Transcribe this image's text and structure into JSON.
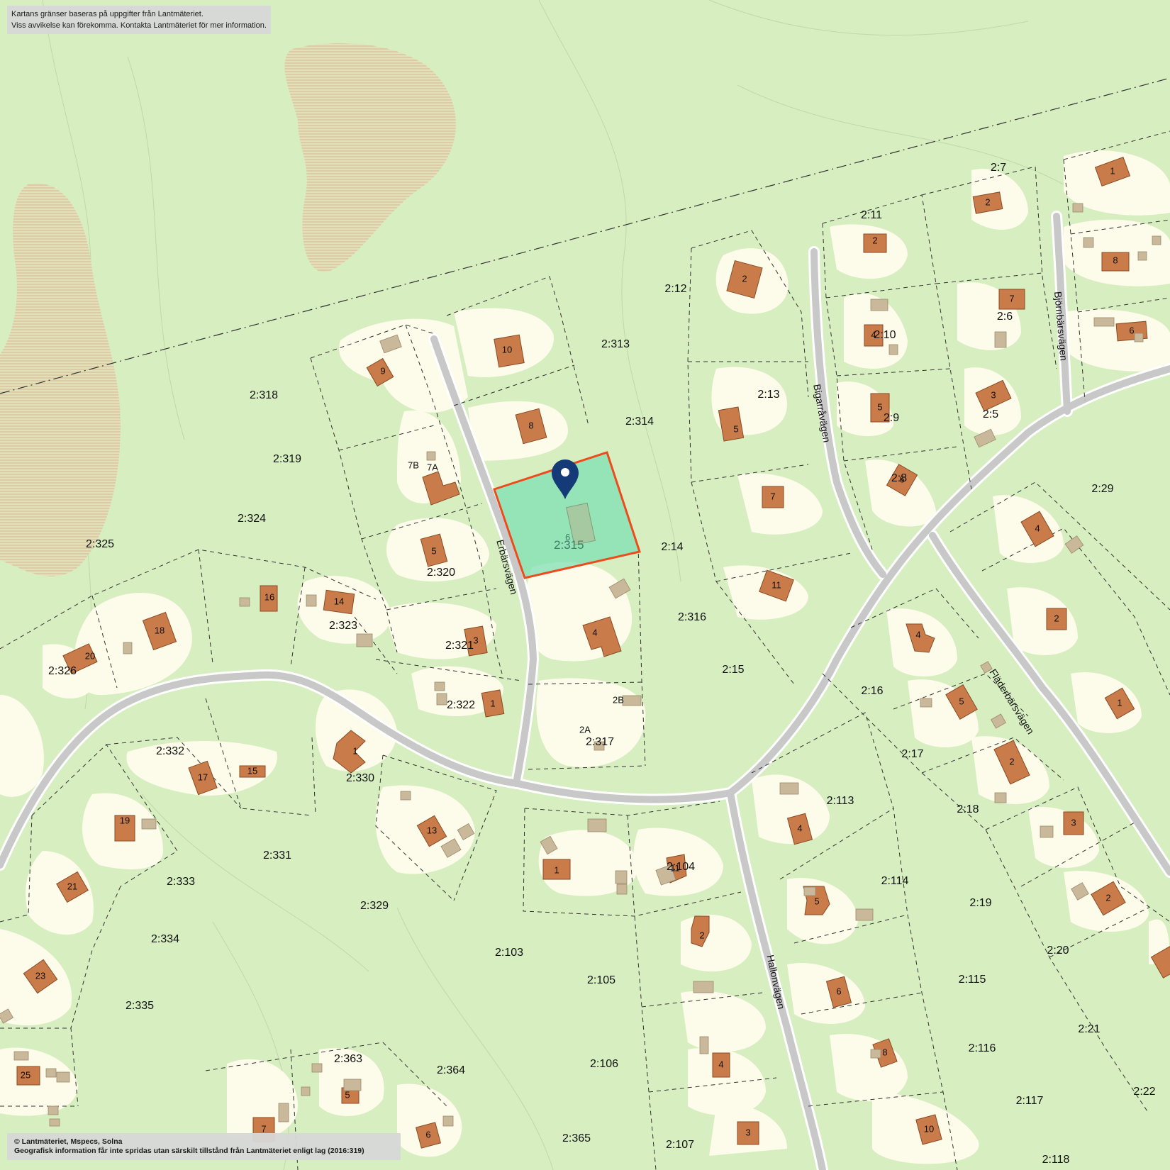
{
  "notice": {
    "line1": "Kartans gränser baseras på uppgifter från Lantmäteriet.",
    "line2": "Viss avvikelse kan förekomma. Kontakta Lantmäteriet för mer information."
  },
  "attribution": {
    "line1": "© Lantmäteriet, Mspecs, Solna",
    "line2": "Geografisk information får inte spridas utan särskilt tillstånd från Lantmäteriet enligt lag (2016:319)"
  },
  "colors": {
    "background": "#d6eec0",
    "settlement": "#fdfbe9",
    "building": "#c97b4a",
    "outbuilding": "#c9b99a",
    "road": "#c8c8c8",
    "highlight_fill": "#7fe0b4",
    "highlight_border": "#ee4b1c",
    "marker": "#143b78"
  },
  "selected_parcel": {
    "label": "2:315",
    "house_number": "6",
    "marker": "location-pin-icon"
  },
  "roads": [
    {
      "name": "Erbärsvägen",
      "rotate": 75
    },
    {
      "name": "Bigarråvägen",
      "rotate": 80
    },
    {
      "name": "Björnbärsvägen",
      "rotate": 85
    },
    {
      "name": "Fläderbärsvägen",
      "rotate": 58
    },
    {
      "name": "Hallonvägen",
      "rotate": 78
    }
  ],
  "parcel_labels": [
    "2:318",
    "2:319",
    "2:324",
    "2:325",
    "2:326",
    "2:320",
    "2:323",
    "2:321",
    "2:322",
    "2:313",
    "2:314",
    "2:12",
    "2:14",
    "2:316",
    "2:15",
    "2:317",
    "2:13",
    "2:7",
    "2:11",
    "2:6",
    "2:10",
    "2:9",
    "2:5",
    "2:8",
    "2:29",
    "2:16",
    "2:17",
    "2:18",
    "2:113",
    "2:114",
    "2:19",
    "2:20",
    "2:115",
    "2:21",
    "2:116",
    "2:117",
    "2:22",
    "2:118",
    "2:332",
    "2:330",
    "2:331",
    "2:333",
    "2:329",
    "2:334",
    "2:335",
    "2:103",
    "2:104",
    "2:105",
    "2:106",
    "2:107",
    "2:363",
    "2:364",
    "2:365"
  ],
  "house_numbers": [
    "10",
    "9",
    "8",
    "7B",
    "7A",
    "5",
    "6",
    "4",
    "2B",
    "2A",
    "3",
    "1",
    "16",
    "14",
    "18",
    "20",
    "13",
    "1",
    "15",
    "17",
    "19",
    "21",
    "23",
    "25",
    "27",
    "5",
    "2",
    "7",
    "11",
    "2",
    "4",
    "5",
    "6",
    "2",
    "7",
    "3",
    "1",
    "8",
    "6",
    "4",
    "2",
    "4",
    "5",
    "2",
    "1",
    "3",
    "2",
    "4",
    "5",
    "6",
    "8",
    "10",
    "1",
    "11",
    "2",
    "4",
    "3",
    "5",
    "6",
    "7",
    "8",
    "9"
  ]
}
